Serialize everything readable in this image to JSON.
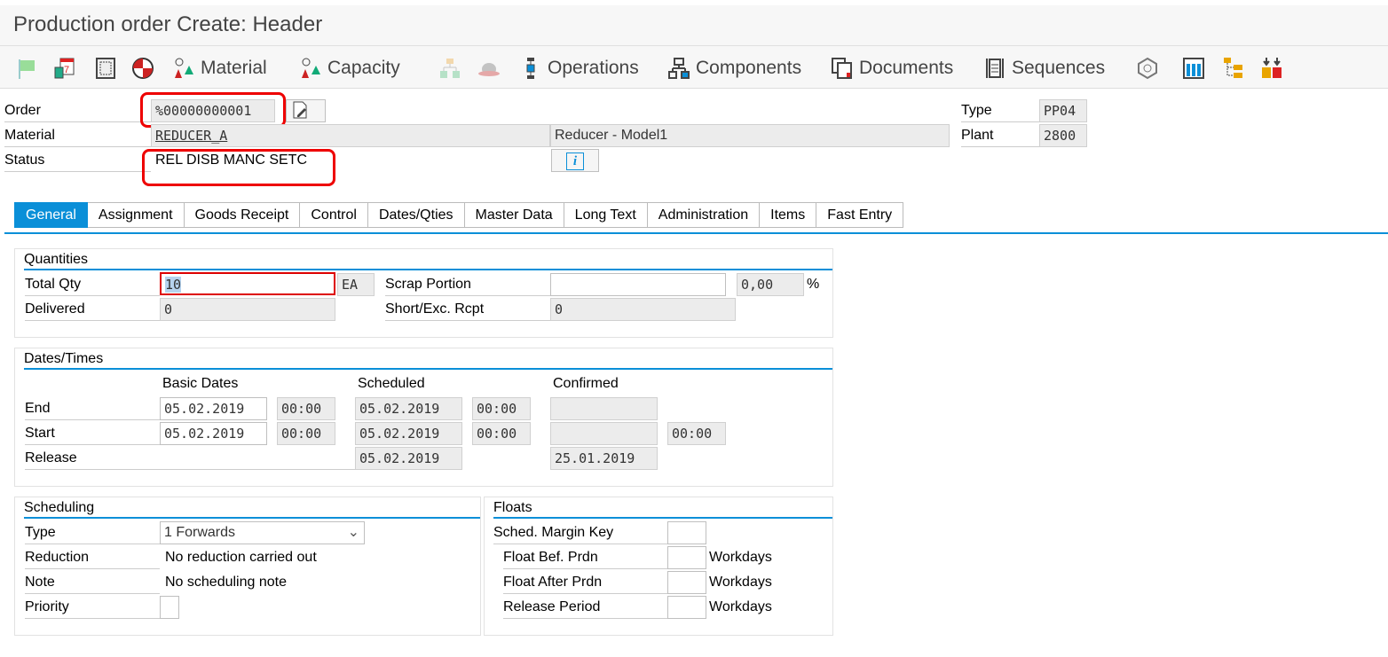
{
  "title": "Production order Create: Header",
  "toolbar": {
    "items": [
      {
        "icon": "flag-icon"
      },
      {
        "icon": "calendar-icon"
      },
      {
        "icon": "calculator-icon"
      },
      {
        "icon": "pie-chart-icon"
      },
      {
        "icon": "material-availability-icon",
        "label": "Material"
      },
      {
        "icon": "capacity-icon",
        "label": "Capacity"
      },
      {
        "icon": "hierarchy-icon"
      },
      {
        "icon": "hat-icon"
      },
      {
        "icon": "operations-icon",
        "label": "Operations"
      },
      {
        "icon": "components-icon",
        "label": "Components"
      },
      {
        "icon": "documents-icon",
        "label": "Documents"
      },
      {
        "icon": "sequences-icon",
        "label": "Sequences"
      },
      {
        "icon": "network-icon"
      },
      {
        "icon": "table-icon"
      },
      {
        "icon": "tree-icon"
      },
      {
        "icon": "sort-icon"
      }
    ]
  },
  "header": {
    "order_label": "Order",
    "order_value": "%00000000001",
    "material_label": "Material",
    "material_value": "REDUCER_A",
    "material_desc": "Reducer - Model1",
    "status_label": "Status",
    "status_value": "REL  DISB MANC SETC",
    "type_label": "Type",
    "type_value": "PP04",
    "plant_label": "Plant",
    "plant_value": "2800"
  },
  "tabs": [
    "General",
    "Assignment",
    "Goods Receipt",
    "Control",
    "Dates/Qties",
    "Master Data",
    "Long Text",
    "Administration",
    "Items",
    "Fast Entry"
  ],
  "active_tab": "General",
  "quantities": {
    "title": "Quantities",
    "total_qty_label": "Total Qty",
    "total_qty": "10",
    "unit": "EA",
    "scrap_label": "Scrap Portion",
    "scrap_value": "",
    "scrap_pct": "0,00",
    "pct": "%",
    "delivered_label": "Delivered",
    "delivered": "0",
    "short_label": "Short/Exc. Rcpt",
    "short": "0"
  },
  "dates": {
    "title": "Dates/Times",
    "basic": "Basic Dates",
    "scheduled": "Scheduled",
    "confirmed": "Confirmed",
    "end_label": "End",
    "start_label": "Start",
    "release_label": "Release",
    "end_basic_date": "05.02.2019",
    "end_basic_time": "00:00",
    "end_sched_date": "05.02.2019",
    "end_sched_time": "00:00",
    "end_conf": "",
    "start_basic_date": "05.02.2019",
    "start_basic_time": "00:00",
    "start_sched_date": "05.02.2019",
    "start_sched_time": "00:00",
    "start_conf": "",
    "start_conf_time": "00:00",
    "release_sched": "05.02.2019",
    "release_conf": "25.01.2019"
  },
  "scheduling": {
    "title": "Scheduling",
    "type_label": "Type",
    "type_value": "1 Forwards",
    "reduction_label": "Reduction",
    "reduction_value": "No reduction carried out",
    "note_label": "Note",
    "note_value": "No scheduling note",
    "priority_label": "Priority",
    "priority_value": ""
  },
  "floats": {
    "title": "Floats",
    "margin_label": "Sched. Margin Key",
    "bef_label": "Float Bef. Prdn",
    "after_label": "Float After Prdn",
    "release_label": "Release Period",
    "unit": "Workdays"
  },
  "colors": {
    "accent": "#0a8fd8",
    "highlight": "#e00000"
  }
}
